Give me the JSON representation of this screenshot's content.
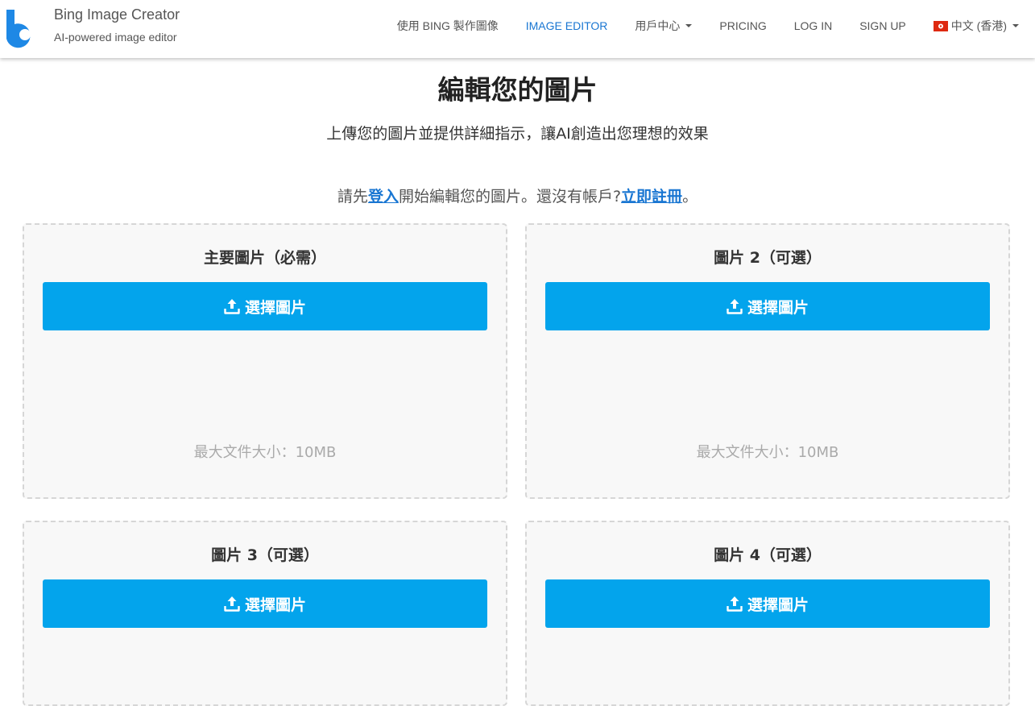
{
  "header": {
    "brand_title": "Bing Image Creator",
    "brand_subtitle": "AI-powered image editor",
    "nav": {
      "create_with_bing": "使用 BING 製作圖像",
      "image_editor": "IMAGE EDITOR",
      "user_center": "用戶中心",
      "pricing": "PRICING",
      "log_in": "LOG IN",
      "sign_up": "SIGN UP",
      "language": "中文 (香港)"
    }
  },
  "main": {
    "title": "編輯您的圖片",
    "subtitle": "上傳您的圖片並提供詳細指示，讓AI創造出您理想的效果",
    "login_note": {
      "before_login": "請先",
      "login_link": "登入",
      "middle": "開始編輯您的圖片。還沒有帳戶?",
      "register_link": "立即註冊",
      "end": "。"
    },
    "cards": [
      {
        "title": "主要圖片（必需）",
        "button": "選擇圖片",
        "size_note": "最大文件大小：10MB"
      },
      {
        "title": "圖片 2（可選）",
        "button": "選擇圖片",
        "size_note": "最大文件大小：10MB"
      },
      {
        "title": "圖片 3（可選）",
        "button": "選擇圖片"
      },
      {
        "title": "圖片 4（可選）",
        "button": "選擇圖片"
      }
    ]
  },
  "colors": {
    "accent": "#03a4ec",
    "link": "#1976d2",
    "card_bg": "#f8f8f8",
    "card_border": "#d6d6d6",
    "logo": "#1e88e5"
  },
  "icons": {
    "logo": "bing-logo-icon",
    "upload": "upload-icon",
    "caret": "caret-down-icon",
    "flag": "hong-kong-flag-icon"
  }
}
